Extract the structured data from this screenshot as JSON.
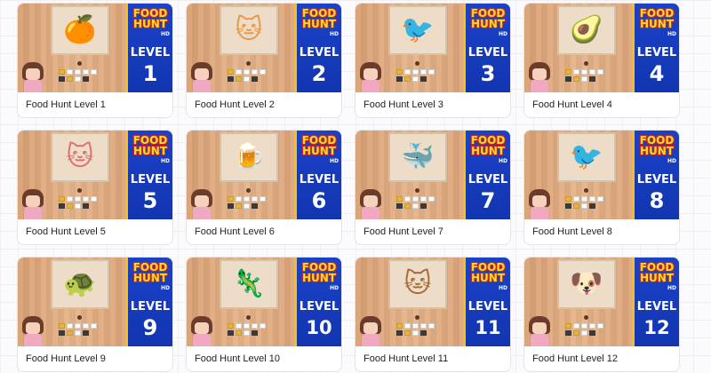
{
  "games": [
    {
      "title": "Food Hunt Level 1",
      "level": "1",
      "art": "🍊",
      "art_color": "#f0922a"
    },
    {
      "title": "Food Hunt Level 2",
      "level": "2",
      "art": "🐱",
      "art_color": "#e69a4a"
    },
    {
      "title": "Food Hunt Level 3",
      "level": "3",
      "art": "🐦",
      "art_color": "#d0322a"
    },
    {
      "title": "Food Hunt Level 4",
      "level": "4",
      "art": "🥑",
      "art_color": "#5c8e2b"
    },
    {
      "title": "Food Hunt Level 5",
      "level": "5",
      "art": "🐱",
      "art_color": "#e07070"
    },
    {
      "title": "Food Hunt Level 6",
      "level": "6",
      "art": "🍺",
      "art_color": "#e6a21d"
    },
    {
      "title": "Food Hunt Level 7",
      "level": "7",
      "art": "🐳",
      "art_color": "#3f8fc9"
    },
    {
      "title": "Food Hunt Level 8",
      "level": "8",
      "art": "🐦",
      "art_color": "#2a2a2a"
    },
    {
      "title": "Food Hunt Level 9",
      "level": "9",
      "art": "🐢",
      "art_color": "#3f9b3a"
    },
    {
      "title": "Food Hunt Level 10",
      "level": "10",
      "art": "🦎",
      "art_color": "#e8a72a"
    },
    {
      "title": "Food Hunt Level 11",
      "level": "11",
      "art": "🐱",
      "art_color": "#a86a3a"
    },
    {
      "title": "Food Hunt Level 12",
      "level": "12",
      "art": "🐶",
      "art_color": "#c83232"
    }
  ],
  "thumbnail": {
    "logo_line1": "FOOD",
    "logo_line2": "HUNT",
    "logo_badge": "HD",
    "level_word": "LEVEL"
  },
  "colors": {
    "panel_blue": "#1a3fc4",
    "logo_yellow": "#ffdc2e",
    "logo_outline": "#c9281b",
    "wood": "#e2ad82"
  }
}
